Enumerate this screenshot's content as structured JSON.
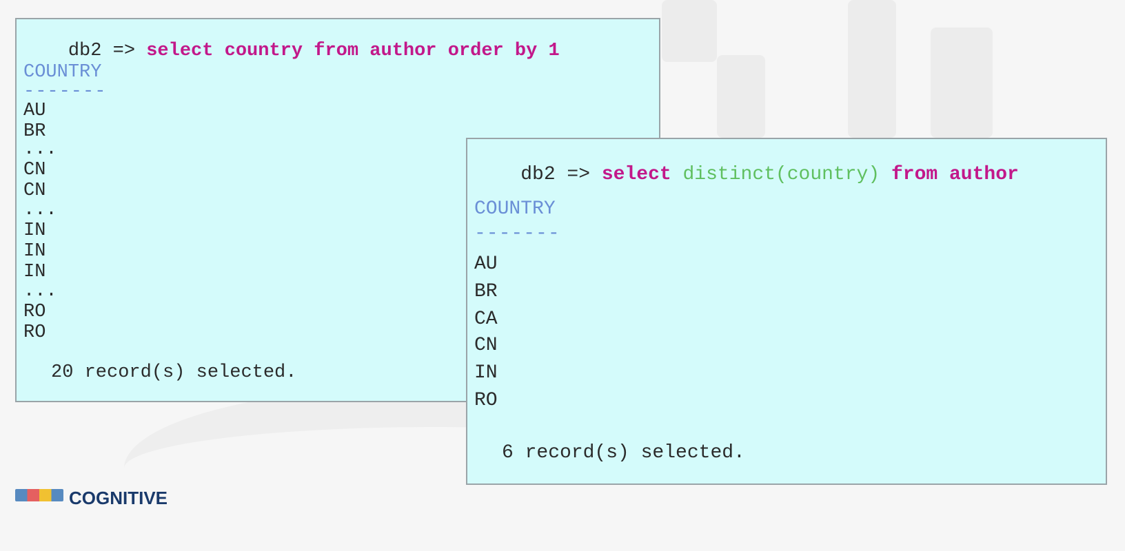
{
  "left_panel": {
    "prompt": "db2 =>",
    "query_parts": [
      {
        "text": "select country from author order by 1",
        "style": "kw"
      }
    ],
    "column_header": "COUNTRY",
    "column_rule": "-------",
    "rows": [
      "AU",
      "BR",
      "...",
      "CN",
      "CN",
      "...",
      "IN",
      "IN",
      "IN",
      "...",
      "RO",
      "RO"
    ],
    "footer": "20 record(s) selected."
  },
  "right_panel": {
    "prompt": "db2 =>",
    "query_select": "select",
    "query_function": "distinct(country)",
    "query_from": "from author",
    "column_header": "COUNTRY",
    "column_rule": "-------",
    "rows": [
      "AU",
      "BR",
      "CA",
      "CN",
      "IN",
      "RO"
    ],
    "footer": "6 record(s) selected."
  },
  "logo": {
    "text": "COGNITIVE"
  },
  "colors": {
    "panel_background": "#d4fbfb",
    "keyword": "#c2188a",
    "function": "#5fbf5f",
    "column_header": "#6a8fd6"
  }
}
